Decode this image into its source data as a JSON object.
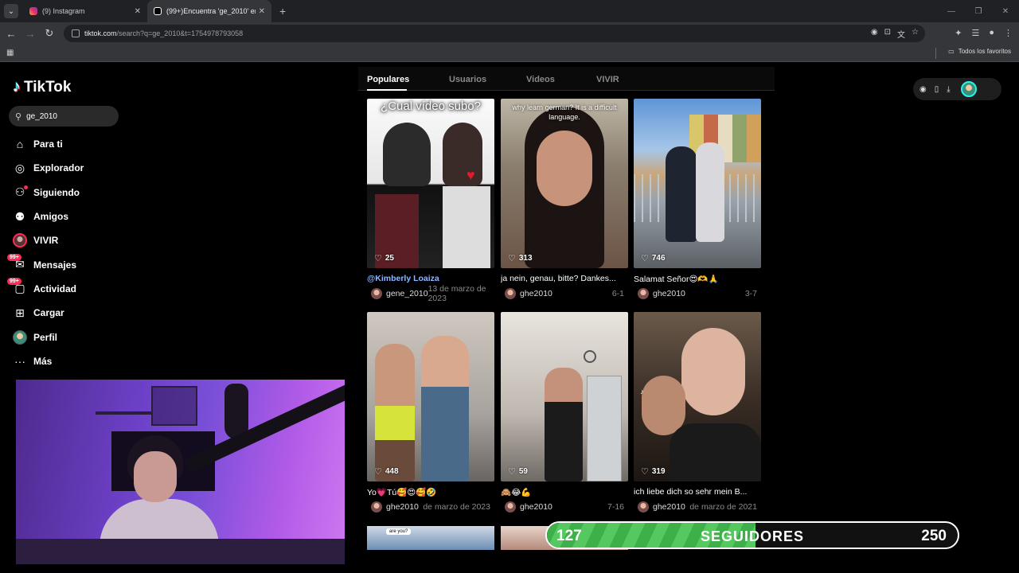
{
  "browser": {
    "tabs": [
      {
        "title": "(9) Instagram"
      },
      {
        "title": "(99+)Encuentra 'ge_2010' en TikTok"
      }
    ],
    "url_host": "tiktok.com",
    "url_path": "/search?q=ge_2010&t=1754978793058",
    "bookmarks_folder": "Todos los favoritos"
  },
  "sidebar": {
    "logo": "TikTok",
    "search_value": "ge_2010",
    "items": [
      {
        "label": "Para ti",
        "icon": "home-icon"
      },
      {
        "label": "Explorador",
        "icon": "compass-icon"
      },
      {
        "label": "Siguiendo",
        "icon": "following-icon"
      },
      {
        "label": "Amigos",
        "icon": "friends-icon"
      },
      {
        "label": "VIVIR",
        "icon": "live-avatar"
      },
      {
        "label": "Mensajes",
        "icon": "messages-icon",
        "badge": "99+"
      },
      {
        "label": "Actividad",
        "icon": "activity-icon",
        "badge": "99+"
      },
      {
        "label": "Cargar",
        "icon": "upload-icon"
      },
      {
        "label": "Perfil",
        "icon": "profile-avatar"
      },
      {
        "label": "Más",
        "icon": "more-icon"
      }
    ]
  },
  "main": {
    "tabs": [
      {
        "label": "Populares",
        "active": true
      },
      {
        "label": "Usuarios"
      },
      {
        "label": "Videos"
      },
      {
        "label": "VIVIR"
      }
    ],
    "videos": [
      {
        "likes": "25",
        "overlay": "¿Cual vídeo subo?",
        "caption": "@Kimberly Loaiza",
        "user": "gene_2010",
        "date": "13 de marzo de 2023"
      },
      {
        "likes": "313",
        "overlay": "why learn german? It is a difficult language.",
        "caption": "ja nein, genau, bitte? Dankes...",
        "user": "ghe2010",
        "date": "6-1"
      },
      {
        "likes": "746",
        "overlay": "",
        "caption": "Salamat Señor😍🫶🙏",
        "user": "ghe2010",
        "date": "3-7"
      },
      {
        "likes": "448",
        "overlay": "",
        "caption": "Yo💗Tú🥰😍🥰🤣",
        "user": "ghe2010",
        "date": "de marzo de 2023"
      },
      {
        "likes": "59",
        "overlay": "",
        "caption": "🙈😂💪",
        "user": "ghe2010",
        "date": "7-16"
      },
      {
        "likes": "319",
        "overlay": "",
        "caption": "ich liebe dich so sehr mein B...",
        "user": "ghe2010",
        "date": "de marzo de 2021"
      }
    ],
    "peek_text": "are you?"
  },
  "followers": {
    "current": "127",
    "label": "SEGUIDORES",
    "goal": "250",
    "progress_fraction": 0.508,
    "accent": "#3eb04a"
  }
}
